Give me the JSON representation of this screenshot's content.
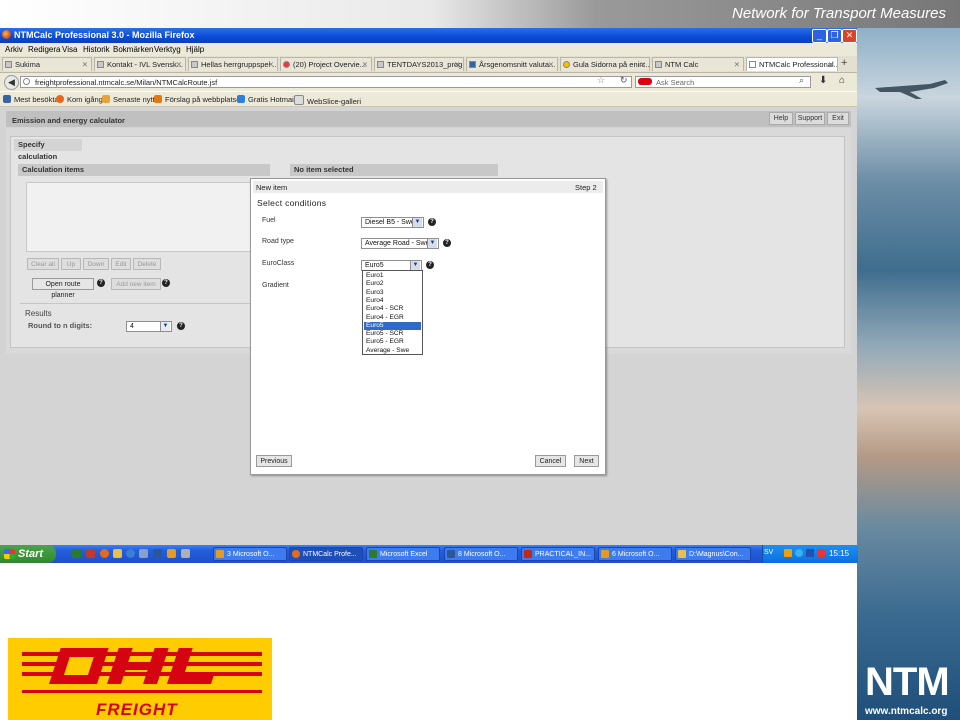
{
  "slide": {
    "title": "Network for Transport Measures",
    "logo_text": "NTM",
    "url": "www.ntmcalc.org",
    "dhl_freight_text": "FREIGHT"
  },
  "browser": {
    "window_title": "NTMCalc Professional 3.0 - Mozilla Firefox",
    "menu": [
      "Arkiv",
      "Redigera",
      "Visa",
      "Historik",
      "Bokmärken",
      "Verktyg",
      "Hjälp"
    ],
    "tabs": [
      {
        "label": "Sukima"
      },
      {
        "label": "Kontakt - IVL Svensk..."
      },
      {
        "label": "Hellas herrgruppspel ..."
      },
      {
        "label": "(20) Project Overvie..."
      },
      {
        "label": "TENTDAYS2013_prog..."
      },
      {
        "label": "Årsgenomsnitt valuta..."
      },
      {
        "label": "Gula Sidorna på enirc..."
      },
      {
        "label": "NTM Calc"
      },
      {
        "label": "NTMCalc Professional..."
      }
    ],
    "url": "freightprofessional.ntmcalc.se/Milan/NTMCalcRoute.jsf",
    "search_placeholder": "Ask Search",
    "bookmarks": [
      "Mest besökta",
      "Kom igång",
      "Senaste nytt",
      "Förslag på webbplatser",
      "Gratis Hotmail",
      "WebSlice-galleri"
    ]
  },
  "app": {
    "title": "Emission and energy calculator",
    "header_buttons": [
      "Help",
      "Support",
      "Exit"
    ],
    "tab": "Specify calculation",
    "calc_items_header": "Calculation items",
    "calc_buttons": [
      "Clear all",
      "Up",
      "Down",
      "Edit",
      "Delete"
    ],
    "open_route_planner": "Open route planner",
    "add_new_item": "Add new item",
    "no_item_header": "No item selected",
    "results_label": "Results",
    "round_label": "Round to n digits:",
    "round_value": "4"
  },
  "dialog": {
    "title": "New item",
    "step": "Step 2",
    "subtitle": "Select conditions",
    "fuel_label": "Fuel",
    "fuel_value": "Diesel B5 - Swe",
    "road_label": "Road type",
    "road_value": "Average Road - Swe",
    "euro_label": "EuroClass",
    "euro_value": "Euro5",
    "gradient_label": "Gradient",
    "euro_options": [
      "Euro1",
      "Euro2",
      "Euro3",
      "Euro4",
      "Euro4 - SCR",
      "Euro4 - EGR",
      "Euro5",
      "Euro5 - SCR",
      "Euro5 - EGR",
      "Average - Swe"
    ],
    "selected_option": "Euro5",
    "previous_label": "Previous",
    "cancel_label": "Cancel",
    "next_label": "Next"
  },
  "taskbar": {
    "start_label": "Start",
    "tasks": [
      {
        "label": "3 Microsoft O..."
      },
      {
        "label": "NTMCalc Profe..."
      },
      {
        "label": "Microsoft Excel"
      },
      {
        "label": "8 Microsoft O..."
      },
      {
        "label": "PRACTICAL_IN..."
      },
      {
        "label": "6 Microsoft O..."
      },
      {
        "label": "D:\\Magnus\\Con..."
      }
    ],
    "language": "SV",
    "clock": "15:15"
  },
  "colors": {
    "xp_blue": "#245edc",
    "start_green": "#3c9a3c",
    "dhl_yellow": "#ffcc00",
    "dhl_red": "#d40511",
    "selection_blue": "#316ac5"
  }
}
